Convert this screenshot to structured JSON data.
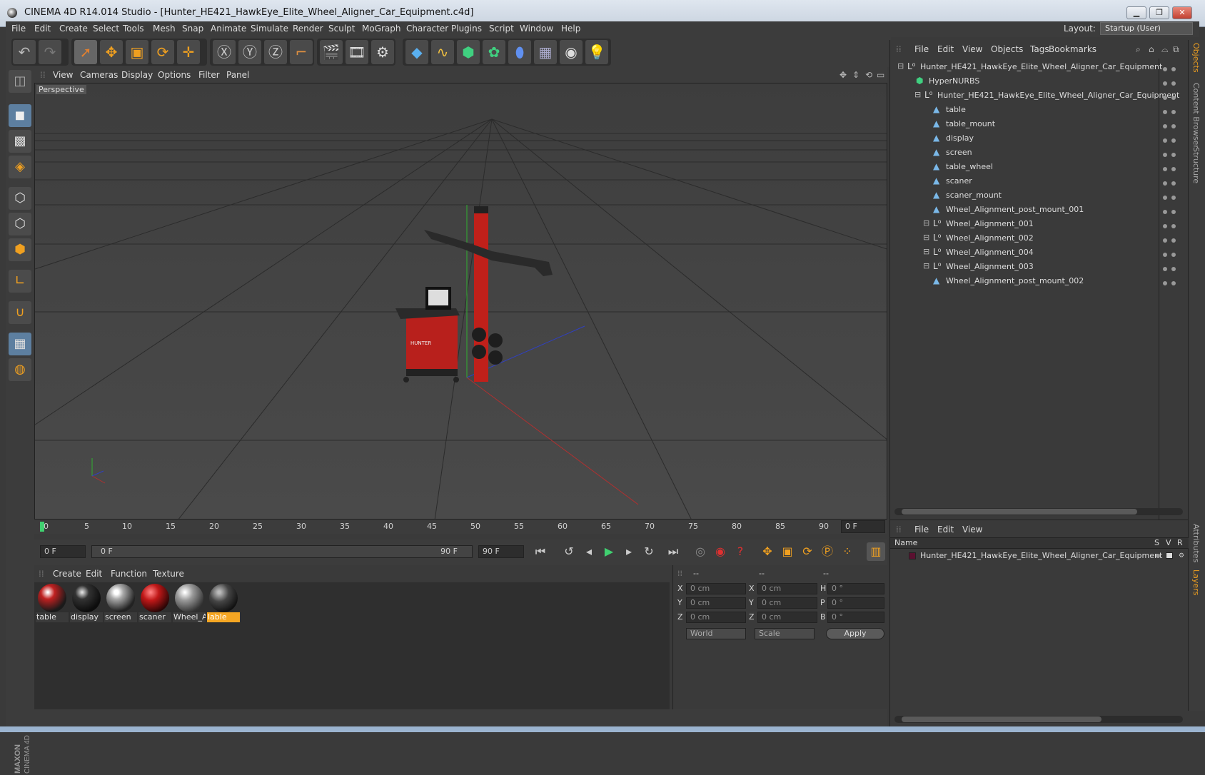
{
  "window": {
    "title": "CINEMA 4D R14.014 Studio - [Hunter_HE421_HawkEye_Elite_Wheel_Aligner_Car_Equipment.c4d]"
  },
  "menu": [
    "File",
    "Edit",
    "Create",
    "Select",
    "Tools",
    "Mesh",
    "Snap",
    "Animate",
    "Simulate",
    "Render",
    "Sculpt",
    "MoGraph",
    "Character",
    "Plugins",
    "Script",
    "Window",
    "Help"
  ],
  "layout": {
    "label": "Layout:",
    "value": "Startup (User)"
  },
  "viewport": {
    "menu": [
      "View",
      "Cameras",
      "Display",
      "Options",
      "Filter",
      "Panel"
    ],
    "camera_label": "Perspective"
  },
  "timeline": {
    "ticks": [
      "0",
      "5",
      "10",
      "15",
      "20",
      "25",
      "30",
      "35",
      "40",
      "45",
      "50",
      "55",
      "60",
      "65",
      "70",
      "75",
      "80",
      "85",
      "90"
    ],
    "current_frame": "0 F",
    "start_field": "0 F",
    "range_start": "0 F",
    "range_end": "90 F",
    "end_field": "90 F"
  },
  "materials": {
    "menu": [
      "Create",
      "Edit",
      "Function",
      "Texture"
    ],
    "items": [
      {
        "label": "table"
      },
      {
        "label": "display"
      },
      {
        "label": "screen"
      },
      {
        "label": "scaner"
      },
      {
        "label": "Wheel_A"
      },
      {
        "label": "lable"
      }
    ]
  },
  "coords": {
    "headers": [
      "--",
      "--",
      "--"
    ],
    "rows": [
      {
        "a": "X",
        "av": "0 cm",
        "b": "X",
        "bv": "0 cm",
        "c": "H",
        "cv": "0 °"
      },
      {
        "a": "Y",
        "av": "0 cm",
        "b": "Y",
        "bv": "0 cm",
        "c": "P",
        "cv": "0 °"
      },
      {
        "a": "Z",
        "av": "0 cm",
        "b": "Z",
        "bv": "0 cm",
        "c": "B",
        "cv": "0 °"
      }
    ],
    "world": "World",
    "scale": "Scale",
    "apply": "Apply"
  },
  "objects": {
    "menu": [
      "File",
      "Edit",
      "View",
      "Objects",
      "Tags",
      "Bookmarks"
    ],
    "items": [
      {
        "label": "Hunter_HE421_HawkEye_Elite_Wheel_Aligner_Car_Equipment",
        "indent": 0,
        "icon": "null"
      },
      {
        "label": "HyperNURBS",
        "indent": 1,
        "icon": "nurbs"
      },
      {
        "label": "Hunter_HE421_HawkEye_Elite_Wheel_Aligner_Car_Equipment",
        "indent": 2,
        "icon": "null"
      },
      {
        "label": "table",
        "indent": 3,
        "icon": "poly"
      },
      {
        "label": "table_mount",
        "indent": 3,
        "icon": "poly"
      },
      {
        "label": "display",
        "indent": 3,
        "icon": "poly"
      },
      {
        "label": "screen",
        "indent": 3,
        "icon": "poly"
      },
      {
        "label": "table_wheel",
        "indent": 3,
        "icon": "poly"
      },
      {
        "label": "scaner",
        "indent": 3,
        "icon": "poly"
      },
      {
        "label": "scaner_mount",
        "indent": 3,
        "icon": "poly"
      },
      {
        "label": "Wheel_Alignment_post_mount_001",
        "indent": 3,
        "icon": "poly"
      },
      {
        "label": "Wheel_Alignment_001",
        "indent": 3,
        "icon": "null"
      },
      {
        "label": "Wheel_Alignment_002",
        "indent": 3,
        "icon": "null"
      },
      {
        "label": "Wheel_Alignment_004",
        "indent": 3,
        "icon": "null"
      },
      {
        "label": "Wheel_Alignment_003",
        "indent": 3,
        "icon": "null"
      },
      {
        "label": "Wheel_Alignment_post_mount_002",
        "indent": 3,
        "icon": "poly"
      }
    ]
  },
  "layers": {
    "menu": [
      "File",
      "Edit",
      "View"
    ],
    "col_name": "Name",
    "col_s": "S",
    "col_v": "V",
    "col_r": "R",
    "row": "Hunter_HE421_HawkEye_Elite_Wheel_Aligner_Car_Equipment"
  },
  "side_tabs": [
    "Objects",
    "Content Browser",
    "Structure",
    "Attributes",
    "Layers"
  ],
  "brand": {
    "maxon": "MAXON",
    "cinema": "CINEMA 4D"
  },
  "colors": {
    "accent": "#f0a020",
    "bg": "#3a3a3a",
    "selected_orange": "#f5a623"
  }
}
